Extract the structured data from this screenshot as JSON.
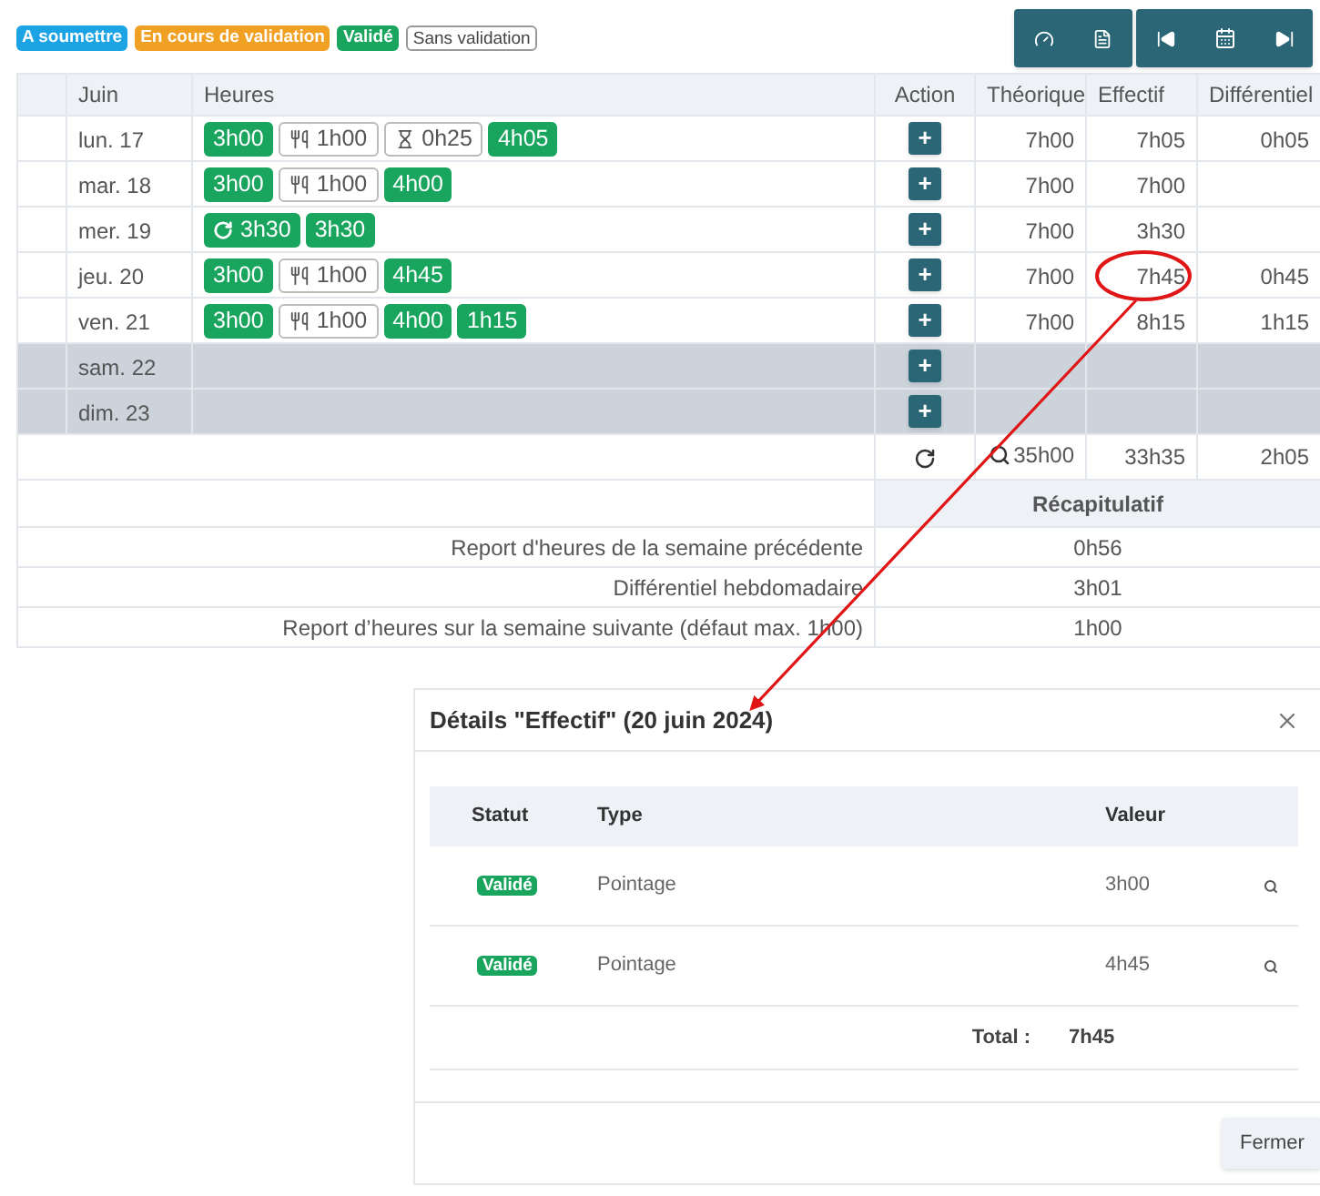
{
  "legend": [
    {
      "label": "A soumettre",
      "kind": "filled",
      "color": "#1ba3e4"
    },
    {
      "label": "En cours de validation",
      "kind": "filled",
      "color": "#f0a023"
    },
    {
      "label": "Validé",
      "kind": "filled",
      "color": "#1aa55f"
    },
    {
      "label": "Sans validation",
      "kind": "outline",
      "color": "#ffffff"
    }
  ],
  "table": {
    "columns": [
      "Juin",
      "Heures",
      "Action",
      "Théorique",
      "Effectif",
      "Différentiel"
    ],
    "rows": [
      {
        "day": "lun. 17",
        "disabled": false,
        "circled": false,
        "entries": [
          {
            "kind": "work",
            "value": "3h00"
          },
          {
            "kind": "meal",
            "value": "1h00"
          },
          {
            "kind": "break",
            "value": "0h25"
          },
          {
            "kind": "work",
            "value": "4h05"
          }
        ],
        "action": "+",
        "theorique": "7h00",
        "effectif": "7h05",
        "differentiel": "0h05"
      },
      {
        "day": "mar. 18",
        "disabled": false,
        "circled": false,
        "entries": [
          {
            "kind": "work",
            "value": "3h00"
          },
          {
            "kind": "meal",
            "value": "1h00"
          },
          {
            "kind": "work",
            "value": "4h00"
          }
        ],
        "action": "+",
        "theorique": "7h00",
        "effectif": "7h00"
      },
      {
        "day": "mer. 19",
        "disabled": false,
        "circled": false,
        "entries": [
          {
            "kind": "recurring",
            "value": "3h30"
          },
          {
            "kind": "work",
            "value": "3h30"
          }
        ],
        "action": "+",
        "theorique": "7h00",
        "effectif": "3h30"
      },
      {
        "day": "jeu. 20",
        "disabled": false,
        "circled": true,
        "entries": [
          {
            "kind": "work",
            "value": "3h00"
          },
          {
            "kind": "meal",
            "value": "1h00"
          },
          {
            "kind": "work",
            "value": "4h45"
          }
        ],
        "action": "+",
        "theorique": "7h00",
        "effectif": "7h45",
        "differentiel": "0h45"
      },
      {
        "day": "ven. 21",
        "disabled": false,
        "circled": false,
        "entries": [
          {
            "kind": "work",
            "value": "3h00"
          },
          {
            "kind": "meal",
            "value": "1h00"
          },
          {
            "kind": "work",
            "value": "4h00"
          },
          {
            "kind": "work",
            "value": "1h15"
          }
        ],
        "action": "+",
        "theorique": "7h00",
        "effectif": "8h15",
        "differentiel": "1h15"
      },
      {
        "day": "sam. 22",
        "disabled": true,
        "circled": false,
        "entries": [],
        "action": "+"
      },
      {
        "day": "dim. 23",
        "disabled": true,
        "circled": false,
        "entries": [],
        "action": "+"
      }
    ],
    "totals": {
      "theorique": "35h00",
      "effectif": "33h35",
      "differentiel": "2h05"
    }
  },
  "summary": {
    "title": "Récapitulatif",
    "rows": [
      {
        "label": "Report d'heures de la semaine précédente",
        "value": "0h56"
      },
      {
        "label": "Différentiel hebdomadaire",
        "value": "3h01"
      },
      {
        "label": "Report d’heures sur la semaine suivante (défaut max. 1h00)",
        "value": "1h00"
      }
    ]
  },
  "dialog": {
    "title": "Détails \"Effectif\" (20 juin 2024)",
    "columns": [
      "Statut",
      "Type",
      "Valeur"
    ],
    "rows": [
      {
        "status": "Validé",
        "type": "Pointage",
        "value": "3h00"
      },
      {
        "status": "Validé",
        "type": "Pointage",
        "value": "4h45"
      }
    ],
    "total_label": "Total :",
    "total": "7h45",
    "close_button": "Fermer"
  }
}
